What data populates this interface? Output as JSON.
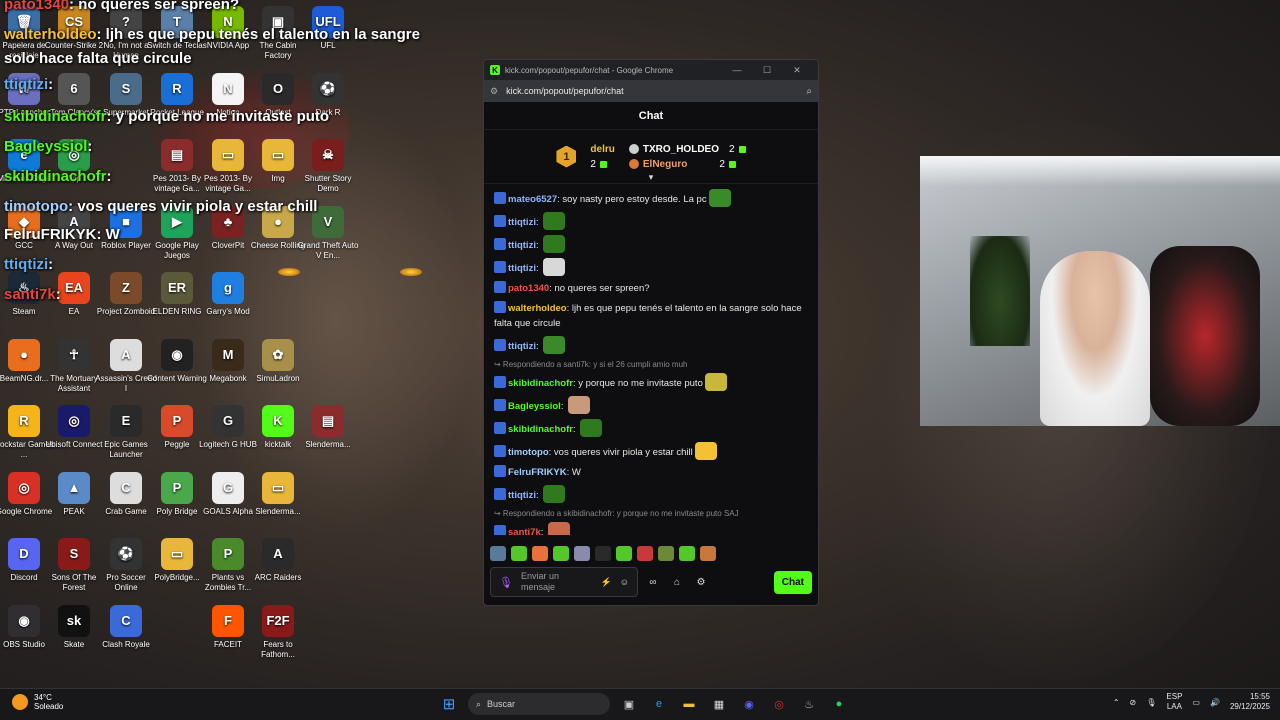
{
  "desktop_icons": [
    {
      "label": "Papelera de reciclaje",
      "glyph": "🗑",
      "color": "#3a6ea5"
    },
    {
      "label": "Counter-Strike 2",
      "glyph": "CS",
      "color": "#c9861f"
    },
    {
      "label": "No, I'm not a Human",
      "glyph": "?",
      "color": "#444"
    },
    {
      "label": "Switch de Teclas",
      "glyph": "T",
      "color": "#5a7fa8"
    },
    {
      "label": "NVIDIA App",
      "glyph": "N",
      "color": "#76b900"
    },
    {
      "label": "The Cabin Factory",
      "glyph": "▣",
      "color": "#333"
    },
    {
      "label": "UFL",
      "glyph": "UFL",
      "color": "#1e5bd8"
    },
    {
      "label": "PTP Launcher",
      "glyph": "W",
      "color": "#6b6fbf"
    },
    {
      "label": "Tom Clancy's",
      "glyph": "6",
      "color": "#555"
    },
    {
      "label": "Supermarket",
      "glyph": "S",
      "color": "#4a6b8a"
    },
    {
      "label": "Rocket League",
      "glyph": "R",
      "color": "#1a6fd6"
    },
    {
      "label": "Notion",
      "glyph": "N",
      "color": "#f4f4f4"
    },
    {
      "label": "Outlast",
      "glyph": "O",
      "color": "#2a2a2a"
    },
    {
      "label": "Dark R",
      "glyph": "⚽",
      "color": "#333"
    },
    {
      "label": "Microsoft Edge",
      "glyph": "e",
      "color": "#0f7bd8"
    },
    {
      "label": "App",
      "glyph": "◎",
      "color": "#2a9d4a"
    },
    {
      "label": "Pes 2013- By vintage Ga...",
      "glyph": "▤",
      "color": "#8a2c2c"
    },
    {
      "label": "Pes 2013- By vintage Ga...",
      "glyph": "▭",
      "color": "#e8b73a"
    },
    {
      "label": "Img",
      "glyph": "▭",
      "color": "#e8b73a"
    },
    {
      "label": "Shutter Story Demo",
      "glyph": "☠",
      "color": "#7a1d1d"
    },
    {
      "label": "GCC",
      "glyph": "◆",
      "color": "#e86d1e"
    },
    {
      "label": "A Way Out",
      "glyph": "A",
      "color": "#444"
    },
    {
      "label": "Roblox Player",
      "glyph": "■",
      "color": "#1e6fe0"
    },
    {
      "label": "Google Play Juegos",
      "glyph": "▶",
      "color": "#1ea35a"
    },
    {
      "label": "CloverPit",
      "glyph": "♣",
      "color": "#7a2222"
    },
    {
      "label": "Cheese Rolling",
      "glyph": "●",
      "color": "#c8a84a"
    },
    {
      "label": "Grand Theft Auto V En...",
      "glyph": "V",
      "color": "#3f6b3a"
    },
    {
      "label": "Steam",
      "glyph": "♨",
      "color": "#1b2838"
    },
    {
      "label": "EA",
      "glyph": "EA",
      "color": "#e8451e"
    },
    {
      "label": "Project Zomboid",
      "glyph": "Z",
      "color": "#7a4a2a"
    },
    {
      "label": "ELDEN RING",
      "glyph": "ER",
      "color": "#5a5a3a"
    },
    {
      "label": "Garry's Mod",
      "glyph": "g",
      "color": "#1e7fe0"
    },
    {
      "label": "BeamNG.dr...",
      "glyph": "●",
      "color": "#e86d1e"
    },
    {
      "label": "The Mortuary Assistant",
      "glyph": "☥",
      "color": "#333"
    },
    {
      "label": "Assassin's Creed I",
      "glyph": "A",
      "color": "#ddd"
    },
    {
      "label": "Content Warning",
      "glyph": "◉",
      "color": "#222"
    },
    {
      "label": "Megabonk",
      "glyph": "M",
      "color": "#3a2a1a"
    },
    {
      "label": "SimuLadron",
      "glyph": "✿",
      "color": "#a8904a"
    },
    {
      "label": "Rockstar Games ...",
      "glyph": "R",
      "color": "#f4b41a"
    },
    {
      "label": "Ubisoft Connect",
      "glyph": "◎",
      "color": "#1a1a6a"
    },
    {
      "label": "Epic Games Launcher",
      "glyph": "E",
      "color": "#2a2a2a"
    },
    {
      "label": "Peggle",
      "glyph": "P",
      "color": "#d84a2a"
    },
    {
      "label": "Logitech G HUB",
      "glyph": "G",
      "color": "#333"
    },
    {
      "label": "kicktalk",
      "glyph": "K",
      "color": "#53fc18"
    },
    {
      "label": "Slenderma...",
      "glyph": "▤",
      "color": "#8a2c2c"
    },
    {
      "label": "Google Chrome",
      "glyph": "◎",
      "color": "#d93025"
    },
    {
      "label": "PEAK",
      "glyph": "▲",
      "color": "#5a8ac8"
    },
    {
      "label": "Crab Game",
      "glyph": "C",
      "color": "#ddd"
    },
    {
      "label": "Poly Bridge",
      "glyph": "P",
      "color": "#4aa84a"
    },
    {
      "label": "GOALS Alpha",
      "glyph": "G",
      "color": "#eee"
    },
    {
      "label": "Slenderma...",
      "glyph": "▭",
      "color": "#e8b73a"
    },
    {
      "label": "Discord",
      "glyph": "D",
      "color": "#5865f2"
    },
    {
      "label": "Sons Of The Forest",
      "glyph": "S",
      "color": "#8a1a1a"
    },
    {
      "label": "Pro Soccer Online",
      "glyph": "⚽",
      "color": "#333"
    },
    {
      "label": "PolyBridge...",
      "glyph": "▭",
      "color": "#e8b73a"
    },
    {
      "label": "Plants vs Zombies Tr...",
      "glyph": "P",
      "color": "#4a8a2a"
    },
    {
      "label": "ARC Raiders",
      "glyph": "A",
      "color": "#2a2a2a"
    },
    {
      "label": "OBS Studio",
      "glyph": "◉",
      "color": "#302e31"
    },
    {
      "label": "Skate",
      "glyph": "sk",
      "color": "#111"
    },
    {
      "label": "Clash Royale",
      "glyph": "C",
      "color": "#3a6ad8"
    },
    {
      "label": "FACEIT",
      "glyph": "F",
      "color": "#ff5500"
    },
    {
      "label": "Fears to Fathom...",
      "glyph": "F2F",
      "color": "#8a1a1a"
    }
  ],
  "overlay_chat": [
    {
      "user": "pato1340",
      "text": ": no queres ser spreen?",
      "color": "#e8453c"
    },
    {
      "user": "walterholdeo",
      "text": ": ljh es que pepu tenés el talento en la sangre",
      "color": "#f3c136"
    },
    {
      "user": "",
      "text": "solo hace falta que circule",
      "color": "#ffffff"
    },
    {
      "user": "ttiqtizi",
      "text": ":",
      "color": "#5fb0f2"
    },
    {
      "user": "skibidinachofr",
      "text": ": y porque no me invitaste puto",
      "color": "#53fc18"
    },
    {
      "user": "Bagleyssiol",
      "text": ":",
      "color": "#53fc18"
    },
    {
      "user": "skibidinachofr",
      "text": ":",
      "color": "#53fc18"
    },
    {
      "user": "timotopo",
      "text": ": vos queres vivir piola y estar chill",
      "color": "#9fd0ff"
    },
    {
      "user": "FelruFRIKYK",
      "text": ": W",
      "color": "#ffffff"
    },
    {
      "user": "ttiqtizi",
      "text": ":",
      "color": "#5fb0f2"
    },
    {
      "user": "santi7k",
      "text": ":",
      "color": "#e8453c"
    }
  ],
  "window": {
    "title": "kick.com/popout/pepufor/chat - Google Chrome",
    "url": "kick.com/popout/pepufor/chat",
    "minimize": "—",
    "maximize": "☐",
    "close": "✕"
  },
  "chat": {
    "header": "Chat",
    "leader": {
      "rank": "1",
      "first_user": "delru",
      "first_count": "2",
      "second_user": "TXRO_HOLDEO",
      "second_count": "2",
      "third_user": "ElNeguro",
      "third_count": "2"
    },
    "messages": [
      {
        "user": "mateo6527",
        "color": "#8fb8ff",
        "text": "soy nasty pero estoy desde. La pc",
        "emote": "#3a8a2a"
      },
      {
        "user": "ttiqtizi",
        "color": "#8fb8ff",
        "text": "",
        "emote": "#2f7a1f"
      },
      {
        "user": "ttiqtizi",
        "color": "#8fb8ff",
        "text": "",
        "emote": "#2f7a1f"
      },
      {
        "user": "ttiqtizi",
        "color": "#8fb8ff",
        "text": "",
        "emote": "#d8d8d8"
      },
      {
        "user": "pato1340",
        "color": "#f0564a",
        "text": "no queres ser spreen?",
        "emote": ""
      },
      {
        "user": "walterholdeo",
        "color": "#f3c136",
        "text": "ljh es que pepu tenés el talento en la sangre solo hace falta que circule",
        "emote": ""
      },
      {
        "user": "ttiqtizi",
        "color": "#8fb8ff",
        "text": "",
        "emote": "#3a8a2a"
      },
      {
        "user": "skibidinachofr",
        "color": "#53fc18",
        "text": "y porque no me invitaste puto",
        "emote": "#c8b83a",
        "reply": "Respondiendo a santi7k: y si el 26 cumpli amio muh"
      },
      {
        "user": "Bagleyssiol",
        "color": "#53fc18",
        "text": "",
        "emote": "#c89a7a"
      },
      {
        "user": "skibidinachofr",
        "color": "#53fc18",
        "text": "",
        "emote": "#2f7a1f"
      },
      {
        "user": "timotopo",
        "color": "#9fd0ff",
        "text": "vos queres vivir piola y estar chill",
        "emote": "#f3c136"
      },
      {
        "user": "FelruFRIKYK",
        "color": "#9fd0ff",
        "text": "W",
        "emote": ""
      },
      {
        "user": "ttiqtizi",
        "color": "#8fb8ff",
        "text": "",
        "emote": "#2f7a1f"
      },
      {
        "user": "santi7k",
        "color": "#f0564a",
        "text": "",
        "emote": "#c86a4a",
        "reply": "Respondiendo a skibidinachofr: y porque no me invitaste puto SAJ"
      }
    ],
    "input_placeholder": "Enviar un mensaje",
    "send_label": "Chat"
  },
  "taskbar": {
    "temperature": "34°C",
    "weather": "Soleado",
    "search_placeholder": "Buscar",
    "lang_top": "ESP",
    "lang_bottom": "LAA",
    "time": "15:55",
    "date": "29/12/2025"
  }
}
